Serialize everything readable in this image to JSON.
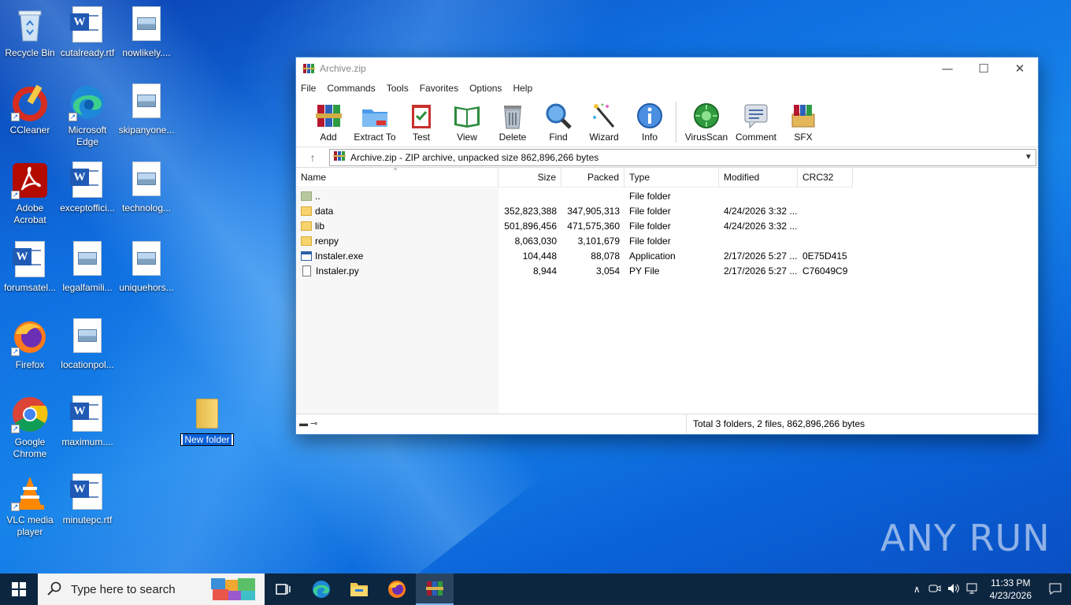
{
  "desktop": {
    "icons": [
      {
        "label": "Recycle Bin",
        "icon": "recycle-bin-icon"
      },
      {
        "label": "cutalready.rtf",
        "icon": "word-document-icon"
      },
      {
        "label": "nowlikely....",
        "icon": "image-file-icon"
      },
      {
        "label": "CCleaner",
        "icon": "ccleaner-icon"
      },
      {
        "label": "Microsoft Edge",
        "icon": "edge-icon"
      },
      {
        "label": "skipanyone...",
        "icon": "image-file-icon"
      },
      {
        "label": "Adobe Acrobat",
        "icon": "acrobat-icon"
      },
      {
        "label": "exceptoffici...",
        "icon": "word-document-icon"
      },
      {
        "label": "technolog...",
        "icon": "image-file-icon"
      },
      {
        "label": "forumsatel...",
        "icon": "word-document-icon"
      },
      {
        "label": "legalfamili...",
        "icon": "image-file-icon"
      },
      {
        "label": "uniquehors...",
        "icon": "image-file-icon"
      },
      {
        "label": "Firefox",
        "icon": "firefox-icon"
      },
      {
        "label": "locationpol...",
        "icon": "image-file-icon"
      },
      {
        "label": "Google Chrome",
        "icon": "chrome-icon"
      },
      {
        "label": "maximum....",
        "icon": "word-document-icon"
      },
      {
        "label": "VLC media player",
        "icon": "vlc-icon"
      },
      {
        "label": "minutepc.rtf",
        "icon": "word-document-icon"
      }
    ],
    "new_folder_label": "New folder",
    "watermark": "ANY RUN"
  },
  "window": {
    "title": "Archive.zip",
    "controls": {
      "minimize": "—",
      "maximize": "☐",
      "close": "✕"
    },
    "menu": [
      "File",
      "Commands",
      "Tools",
      "Favorites",
      "Options",
      "Help"
    ],
    "toolbar": [
      {
        "label": "Add",
        "icon": "add-archive-icon"
      },
      {
        "label": "Extract To",
        "icon": "extract-folder-icon"
      },
      {
        "label": "Test",
        "icon": "test-clipboard-icon"
      },
      {
        "label": "View",
        "icon": "view-book-icon"
      },
      {
        "label": "Delete",
        "icon": "trash-icon"
      },
      {
        "label": "Find",
        "icon": "magnifier-icon"
      },
      {
        "label": "Wizard",
        "icon": "wand-icon"
      },
      {
        "label": "Info",
        "icon": "info-icon"
      },
      {
        "label": "VirusScan",
        "icon": "virus-scan-icon"
      },
      {
        "label": "Comment",
        "icon": "comment-icon"
      },
      {
        "label": "SFX",
        "icon": "sfx-box-icon"
      }
    ],
    "address": "Archive.zip - ZIP archive, unpacked size 862,896,266 bytes",
    "columns": [
      "Name",
      "Size",
      "Packed",
      "Type",
      "Modified",
      "CRC32"
    ],
    "rows": [
      {
        "name": "..",
        "size": "",
        "packed": "",
        "type": "File folder",
        "modified": "",
        "crc": "",
        "kind": "updir"
      },
      {
        "name": "data",
        "size": "352,823,388",
        "packed": "347,905,313",
        "type": "File folder",
        "modified": "4/24/2026 3:32 ...",
        "crc": "",
        "kind": "folder"
      },
      {
        "name": "lib",
        "size": "501,896,456",
        "packed": "471,575,360",
        "type": "File folder",
        "modified": "4/24/2026 3:32 ...",
        "crc": "",
        "kind": "folder"
      },
      {
        "name": "renpy",
        "size": "8,063,030",
        "packed": "3,101,679",
        "type": "File folder",
        "modified": "",
        "crc": "",
        "kind": "folder"
      },
      {
        "name": "Instaler.exe",
        "size": "104,448",
        "packed": "88,078",
        "type": "Application",
        "modified": "2/17/2026 5:27 ...",
        "crc": "0E75D415",
        "kind": "exe"
      },
      {
        "name": "Instaler.py",
        "size": "8,944",
        "packed": "3,054",
        "type": "PY File",
        "modified": "2/17/2026 5:27 ...",
        "crc": "C76049C9",
        "kind": "file"
      }
    ],
    "status": "Total 3 folders, 2 files, 862,896,266 bytes"
  },
  "taskbar": {
    "search_placeholder": "Type here to search",
    "time": "11:33 PM",
    "date": "4/23/2026"
  }
}
